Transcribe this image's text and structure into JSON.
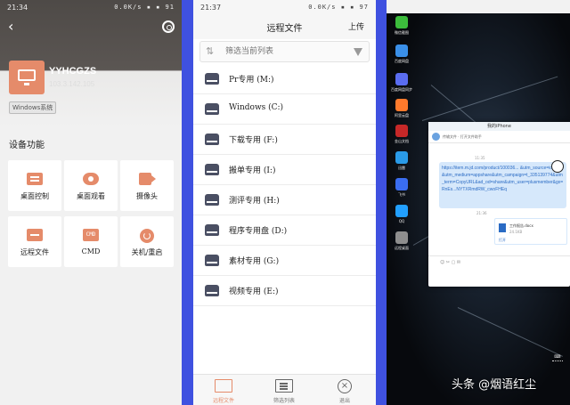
{
  "panel1": {
    "status_time": "21:34",
    "status_right": "0.0K/s ▪ ▪ 91",
    "device_name": "YYHCGZS",
    "device_ip": "103.3.142.105",
    "os_tag": "Windows系统",
    "section_title": "设备功能",
    "functions": [
      {
        "label": "桌面控制",
        "icon": "desktop-control-icon"
      },
      {
        "label": "桌面观看",
        "icon": "eye-icon"
      },
      {
        "label": "摄像头",
        "icon": "camera-icon"
      },
      {
        "label": "远程文件",
        "icon": "folder-icon"
      },
      {
        "label": "CMD",
        "icon": "cmd-icon"
      },
      {
        "label": "关机/重启",
        "icon": "power-icon"
      }
    ]
  },
  "panel2": {
    "status_time": "21:37",
    "status_right": "0.0K/s ▪ ▪ 97",
    "title": "远程文件",
    "upload_label": "上传",
    "filter_placeholder": "筛选当前列表",
    "drives": [
      "Pr专用 (M:)",
      "Windows (C:)",
      "下载专用 (F:)",
      "搬单专用 (I:)",
      "测评专用 (H:)",
      "程序专用盘 (D:)",
      "素材专用 (G:)",
      "视频专用 (E:)"
    ],
    "tabs": [
      {
        "label": "远程文件",
        "icon": "folder-icon",
        "active": true
      },
      {
        "label": "筛选列表",
        "icon": "list-icon",
        "active": false
      },
      {
        "label": "退出",
        "icon": "close-circle-icon",
        "active": false
      }
    ]
  },
  "panel3": {
    "desktop_icons": [
      {
        "label": "微信截图",
        "color": "#3cbc3c"
      },
      {
        "label": "百度网盘",
        "color": "#3a8fe8"
      },
      {
        "label": "百度网盘同步",
        "color": "#5a6cf0"
      },
      {
        "label": "阿里云盘",
        "color": "#ff7a2c"
      },
      {
        "label": "金山文档",
        "color": "#c62828"
      },
      {
        "label": "迅雷",
        "color": "#2a9be8"
      },
      {
        "label": "飞书",
        "color": "#3a6df0"
      },
      {
        "label": "QQ",
        "color": "#22a0ff"
      },
      {
        "label": "远程桌面",
        "color": "#8e8e8e"
      }
    ],
    "chat_title": "我的iPhone",
    "chat_toolbar": "传输文件 · 打开文件助手",
    "msg_time1": "11:35",
    "link_text": "https://item.m.jd.com/product/100036... &utm_source=iosapp&utm_medium=appshare&utm_campaign=t_335139774&utm_term=CopyURL&ad_od=share&utm_user=plusmember&gx=RnEs...NYTXRmdRW_cwoFHEq",
    "msg_time2": "21:36",
    "file_name": "工作报告.docx",
    "file_size": "24.1KB",
    "file_action": "打开",
    "input_tools": "☺ ✂ ▢ ✉",
    "watermark": "头条 @烟语红尘"
  }
}
